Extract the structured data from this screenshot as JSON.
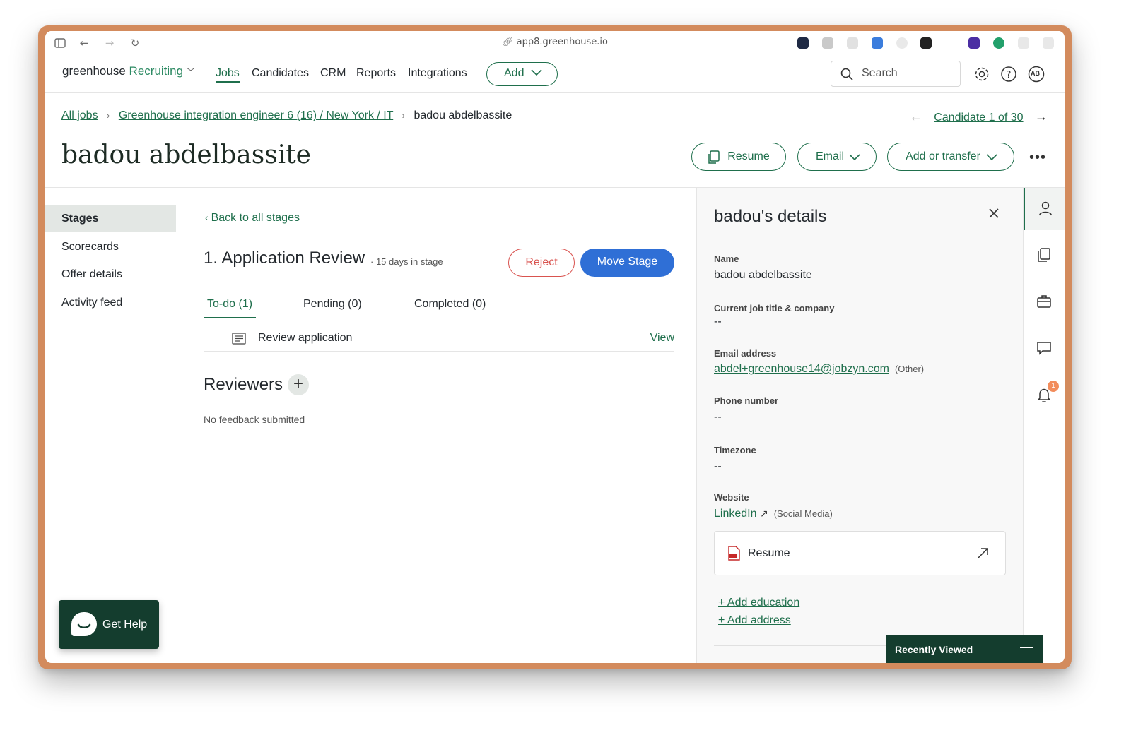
{
  "browser": {
    "url": "app8.greenhouse.io"
  },
  "nav": {
    "brand_main": "greenhouse",
    "brand_product": "Recruiting",
    "items": [
      {
        "label": "Jobs",
        "active": true
      },
      {
        "label": "Candidates",
        "active": false
      },
      {
        "label": "CRM",
        "active": false
      },
      {
        "label": "Reports",
        "active": false
      },
      {
        "label": "Integrations",
        "active": false
      }
    ],
    "add_label": "Add",
    "search_placeholder": "Search",
    "avatar_initials": "AB"
  },
  "breadcrumb": {
    "all_jobs": "All jobs",
    "job": "Greenhouse integration engineer 6 (16) / New York / IT",
    "current": "badou abdelbassite",
    "candidate_counter": "Candidate 1 of 30"
  },
  "candidate": {
    "name": "badou abdelbassite",
    "actions": {
      "resume": "Resume",
      "email": "Email",
      "add_or_transfer": "Add or transfer"
    }
  },
  "sidebar": {
    "items": [
      {
        "label": "Stages",
        "active": true
      },
      {
        "label": "Scorecards",
        "active": false
      },
      {
        "label": "Offer details",
        "active": false
      },
      {
        "label": "Activity feed",
        "active": false
      }
    ]
  },
  "stage": {
    "back_link": "Back to all stages",
    "title": "1. Application Review",
    "days": "15 days in stage",
    "reject": "Reject",
    "move": "Move Stage",
    "tabs": [
      "To-do (1)",
      "Pending (0)",
      "Completed (0)"
    ],
    "todo_item": "Review application",
    "todo_action": "View",
    "reviewers_title": "Reviewers",
    "no_feedback": "No feedback submitted"
  },
  "details": {
    "title": "badou's details",
    "fields": {
      "name_label": "Name",
      "name_value": "badou abdelbassite",
      "job_label": "Current job title & company",
      "job_value": "--",
      "email_label": "Email address",
      "email_value": "abdel+greenhouse14@jobzyn.com",
      "email_type": "(Other)",
      "phone_label": "Phone number",
      "phone_value": "--",
      "timezone_label": "Timezone",
      "timezone_value": "--",
      "website_label": "Website",
      "website_value": "LinkedIn",
      "website_type": "(Social Media)"
    },
    "resume_card": "Resume",
    "add_education": "+ Add education",
    "add_address": "+ Add address"
  },
  "rail": {
    "notification_count": "1"
  },
  "floating": {
    "get_help": "Get Help",
    "recently_viewed": "Recently Viewed"
  },
  "colors": {
    "brand_green": "#1f6f4c",
    "primary_blue": "#2f6fd6",
    "reject_red": "#d9534f",
    "dark_green": "#143d2e"
  }
}
